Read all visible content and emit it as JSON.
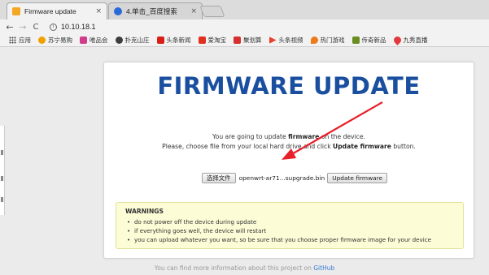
{
  "browser": {
    "tabs": [
      {
        "title": "Firmware update",
        "close": "×",
        "favicon_color": "#f5a623"
      },
      {
        "title": "4.单击_百度搜索",
        "close": "×",
        "favicon_color": "#2a6ad8"
      }
    ],
    "url": "10.10.18.1",
    "nav": {
      "back": "←",
      "forward": "→",
      "reload": "C"
    },
    "info_glyph": "i"
  },
  "bookmarks": [
    {
      "label": "应用",
      "icon": "apps-grid-icon",
      "color": "#444444"
    },
    {
      "label": "苏宁易购",
      "icon": "suning-icon",
      "color": "#f0a000"
    },
    {
      "label": "唯品会",
      "icon": "vip-icon",
      "color": "#d23c8c"
    },
    {
      "label": "扑克山庄",
      "icon": "poker-icon",
      "color": "#3d3d3d"
    },
    {
      "label": "头条新闻",
      "icon": "news-icon",
      "color": "#d91e18"
    },
    {
      "label": "爱淘宝",
      "icon": "taobao-icon",
      "color": "#e0301e"
    },
    {
      "label": "聚划算",
      "icon": "juhuasuan-icon",
      "color": "#d62f2f"
    },
    {
      "label": "头条视频",
      "icon": "video-icon",
      "color": "#e8412c"
    },
    {
      "label": "热门游戏",
      "icon": "game-icon",
      "color": "#f07a1a"
    },
    {
      "label": "传奇新品",
      "icon": "legend-icon",
      "color": "#6b8e23"
    },
    {
      "label": "九秀直播",
      "icon": "live-icon",
      "color": "#e2393f"
    }
  ],
  "page": {
    "headline": "FIRMWARE UPDATE",
    "intro": {
      "line1_pre": "You are going to update ",
      "line1_bold": "firmware",
      "line1_post": " on the device.",
      "line2_pre": "Please, choose file from your local hard drive and click ",
      "line2_bold": "Update firmware",
      "line2_post": " button."
    },
    "form": {
      "choose_label": "选择文件",
      "file_name": "openwrt-ar71...supgrade.bin",
      "update_label": "Update firmware"
    },
    "warnings": {
      "title": "WARNINGS",
      "items": [
        "do not power off the device during update",
        "if everything goes well, the device will restart",
        "you can upload whatever you want, so be sure that you choose proper firmware image for your device"
      ]
    },
    "footer": {
      "text": "You can find more information about this project on ",
      "link": "GitHub"
    }
  },
  "colors": {
    "headline": "#1a4fa0",
    "warning_bg": "#fcfcd6",
    "annotation_arrow": "#e8202a",
    "link": "#3b7bd4"
  }
}
